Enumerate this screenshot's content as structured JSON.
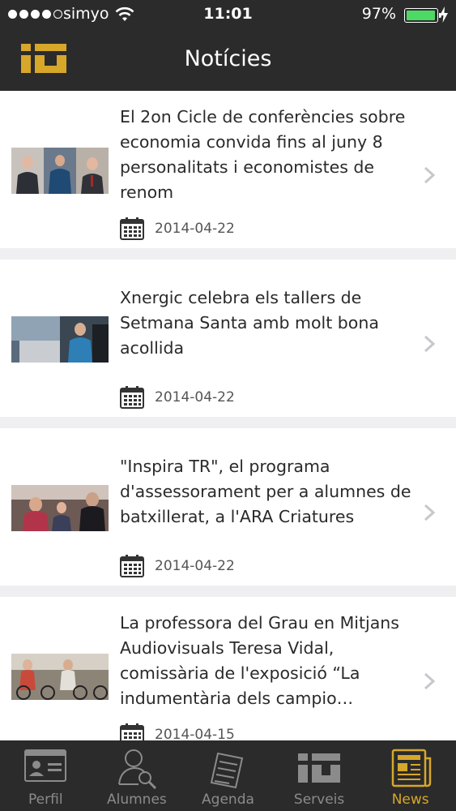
{
  "status_bar": {
    "carrier": "simyo",
    "time": "11:01",
    "battery": "97%",
    "battery_level": 0.97
  },
  "header": {
    "title": "Notícies",
    "logo_icon": "app-logo-icon"
  },
  "news": [
    {
      "headline": "El 2on Cicle de conferències sobre economia convida fins al juny 8 personalitats i economistes de renom",
      "date": "2014-04-22"
    },
    {
      "headline": "Xnergic celebra els tallers de Setmana Santa amb molt bona acollida",
      "date": "2014-04-22"
    },
    {
      "headline": "\"Inspira TR\", el programa d'assessorament per a alumnes de batxillerat, a l'ARA Criatures",
      "date": "2014-04-22"
    },
    {
      "headline": "La professora del Grau en Mitjans Audiovisuals Teresa Vidal, comissària de l'exposició “La indumentària dels campio…",
      "date": "2014-04-15"
    }
  ],
  "tabs": [
    {
      "label": "Perfil",
      "icon": "id-card-icon",
      "active": false
    },
    {
      "label": "Alumnes",
      "icon": "user-search-icon",
      "active": false
    },
    {
      "label": "Agenda",
      "icon": "notebook-icon",
      "active": false
    },
    {
      "label": "Serveis",
      "icon": "services-logo-icon",
      "active": false
    },
    {
      "label": "News",
      "icon": "newspaper-icon",
      "active": true
    }
  ],
  "colors": {
    "header_bg": "#2b2b2b",
    "accent": "#d7a72a",
    "battery": "#4cd964"
  }
}
